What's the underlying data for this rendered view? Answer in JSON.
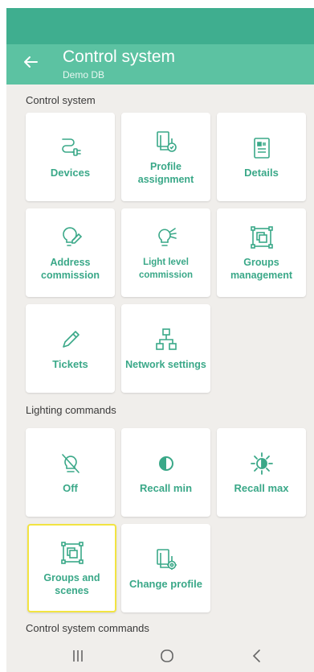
{
  "header": {
    "title": "Control system",
    "subtitle": "Demo DB",
    "back_icon": "arrow-left-icon"
  },
  "sections": {
    "control_system": {
      "title": "Control system",
      "tiles": [
        {
          "label": "Devices",
          "icon": "plug-icon"
        },
        {
          "label": "Profile assignment",
          "icon": "profile-stack-icon"
        },
        {
          "label": "Details",
          "icon": "document-icon"
        },
        {
          "label": "Address commission",
          "icon": "bulb-edit-icon"
        },
        {
          "label": "Light level commission",
          "icon": "bulb-light-icon"
        },
        {
          "label": "Groups management",
          "icon": "groups-icon"
        },
        {
          "label": "Tickets",
          "icon": "pencil-icon"
        },
        {
          "label": "Network settings",
          "icon": "network-icon"
        }
      ]
    },
    "lighting_commands": {
      "title": "Lighting commands",
      "tiles": [
        {
          "label": "Off",
          "icon": "bulb-off-icon"
        },
        {
          "label": "Recall min",
          "icon": "half-circle-icon"
        },
        {
          "label": "Recall max",
          "icon": "sun-icon"
        },
        {
          "label": "Groups and scenes",
          "icon": "groups-icon"
        },
        {
          "label": "Change profile",
          "icon": "profile-settings-icon"
        }
      ]
    },
    "control_system_commands": {
      "title": "Control system commands"
    }
  },
  "nav": {
    "recents_icon": "recents-icon",
    "home_icon": "home-icon",
    "back_icon": "back-chevron-icon"
  },
  "colors": {
    "status_bar": "#3fae8f",
    "app_bar": "#5cc2a2",
    "accent": "#3aa888",
    "highlight": "#f2e442",
    "background": "#f0eeeb"
  }
}
